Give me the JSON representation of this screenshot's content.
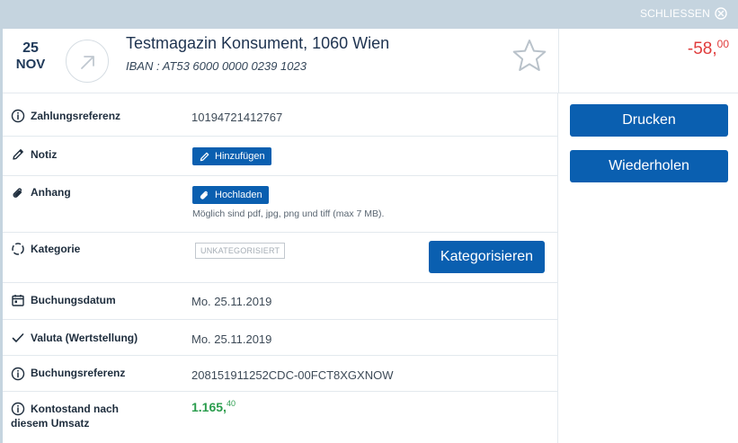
{
  "topbar": {
    "close_label": "SCHLIESSEN",
    "close_icon": "close-circle-icon"
  },
  "transaction": {
    "day": "25",
    "month": "NOV",
    "direction_icon": "arrow-up-right-icon",
    "merchant": "Testmagazin Konsument, 1060 Wien",
    "iban": "IBAN : AT53 6000 0000 0239 1023",
    "favorite_icon": "star-icon",
    "amount_main": "-58,",
    "amount_cents": "00",
    "amount_color": "#e03c3c"
  },
  "details": {
    "zahlungsreferenz": {
      "label": "Zahlungsreferenz",
      "value": "10194721412767"
    },
    "notiz": {
      "label": "Notiz",
      "button": "Hinzufügen"
    },
    "anhang": {
      "label": "Anhang",
      "button": "Hochladen",
      "hint": "Möglich sind pdf, jpg, png und tiff (max 7 MB)."
    },
    "kategorie": {
      "label": "Kategorie",
      "tag": "UNKATEGORISIERT",
      "button": "Kategorisieren"
    },
    "buchungsdatum": {
      "label": "Buchungsdatum",
      "value": "Mo. 25.11.2019"
    },
    "valuta": {
      "label": "Valuta (Wertstellung)",
      "value": "Mo. 25.11.2019"
    },
    "buchungsreferenz": {
      "label": "Buchungsreferenz",
      "value": "208151911252CDC-00FCT8XGXNOW"
    },
    "kontostand": {
      "label_line1": "Kontostand nach",
      "label_line2": "diesem Umsatz",
      "value_main": "1.165,",
      "value_cents": "40",
      "value_color": "#2a9d4d"
    }
  },
  "actions": {
    "drucken": "Drucken",
    "wiederholen": "Wiederholen"
  },
  "colors": {
    "primary": "#0a5fb0",
    "topbar": "#c5d4df"
  }
}
